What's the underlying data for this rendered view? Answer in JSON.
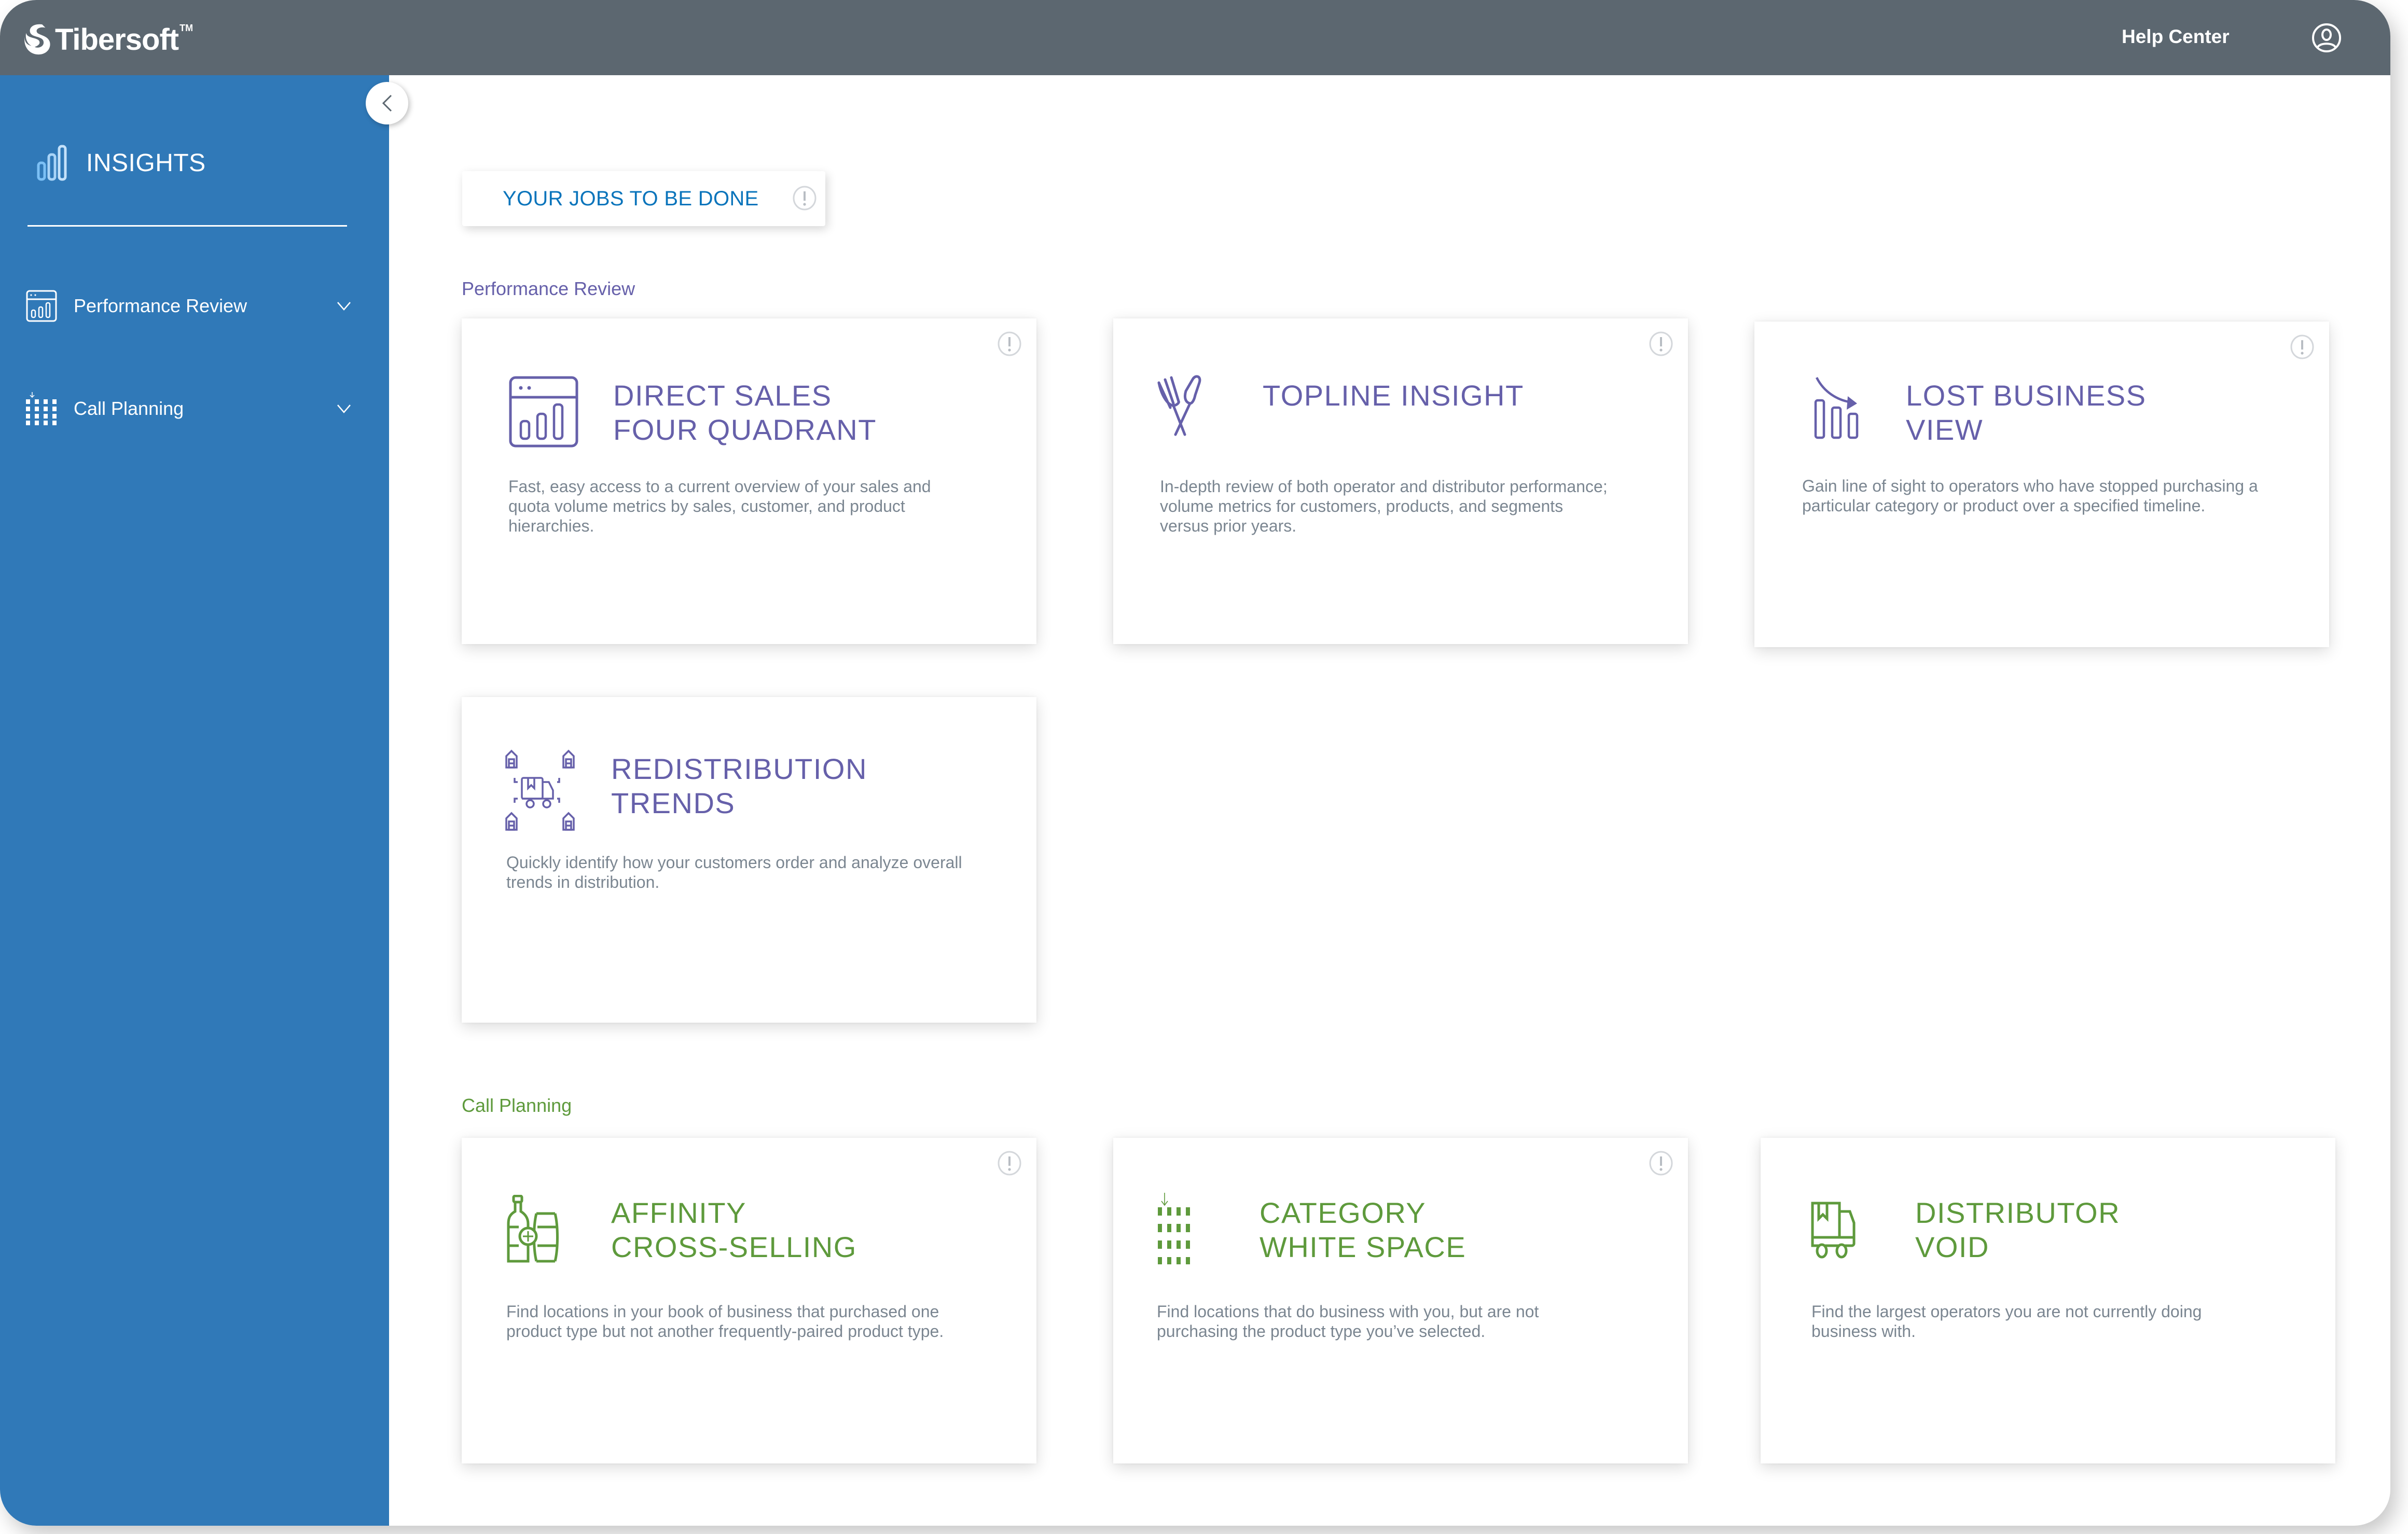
{
  "header": {
    "brand": "Tibersoft",
    "brand_tm": "TM",
    "help_label": "Help Center",
    "user_icon": "user-circle-icon"
  },
  "sidebar": {
    "title": "INSIGHTS",
    "title_icon": "bar-chart-icon",
    "collapse_icon": "chevron-left-icon",
    "items": [
      {
        "label": "Performance Review",
        "icon": "dashboard-chart-icon",
        "expand_icon": "chevron-down-icon"
      },
      {
        "label": "Call Planning",
        "icon": "grid-dots-icon",
        "expand_icon": "chevron-down-icon"
      }
    ]
  },
  "main": {
    "jobs_label": "YOUR JOBS TO BE DONE",
    "sections": [
      {
        "label": "Performance Review",
        "cards": [
          {
            "title": "DIRECT SALES\nFOUR QUADRANT",
            "description": "Fast, easy access to a current overview of your sales and quota volume metrics by sales, customer, and product hierarchies.",
            "icon": "dashboard-chart-icon",
            "has_info": true
          },
          {
            "title": "TOPLINE INSIGHT",
            "description": "In-depth review of both operator and distributor performance; volume metrics for customers, products, and segments versus prior years.",
            "icon": "fork-spoon-icon",
            "has_info": true
          },
          {
            "title": "LOST BUSINESS\nVIEW",
            "description": "Gain line of sight to operators who have stopped purchasing a particular category or product over a specified timeline.",
            "icon": "declining-bars-icon",
            "has_info": true
          },
          {
            "title": "REDISTRIBUTION\nTRENDS",
            "description": "Quickly identify how your customers order and analyze overall trends in distribution.",
            "icon": "truck-warehouses-icon",
            "has_info": false
          }
        ]
      },
      {
        "label": "Call Planning",
        "cards": [
          {
            "title": "AFFINITY\nCROSS-SELLING",
            "description": "Find locations in your book of business that purchased one product type but not another frequently-paired product type.",
            "icon": "bottle-barrel-plus-icon",
            "has_info": true
          },
          {
            "title": "CATEGORY\nWHITE SPACE",
            "description": "Find locations that do business with you, but are not purchasing the product type you’ve selected.",
            "icon": "grid-dots-icon",
            "has_info": true
          },
          {
            "title": "DISTRIBUTOR\nVOID",
            "description": "Find the largest operators you are not currently doing business with.",
            "icon": "delivery-truck-icon",
            "has_info": false
          }
        ]
      }
    ]
  },
  "colors": {
    "header_bg": "#5c6770",
    "sidebar_bg": "#3079b8",
    "performance_accent": "#6660aa",
    "call_planning_accent": "#5e9a3c",
    "jobs_label": "#0a74bb",
    "description_text": "#7b8691"
  }
}
